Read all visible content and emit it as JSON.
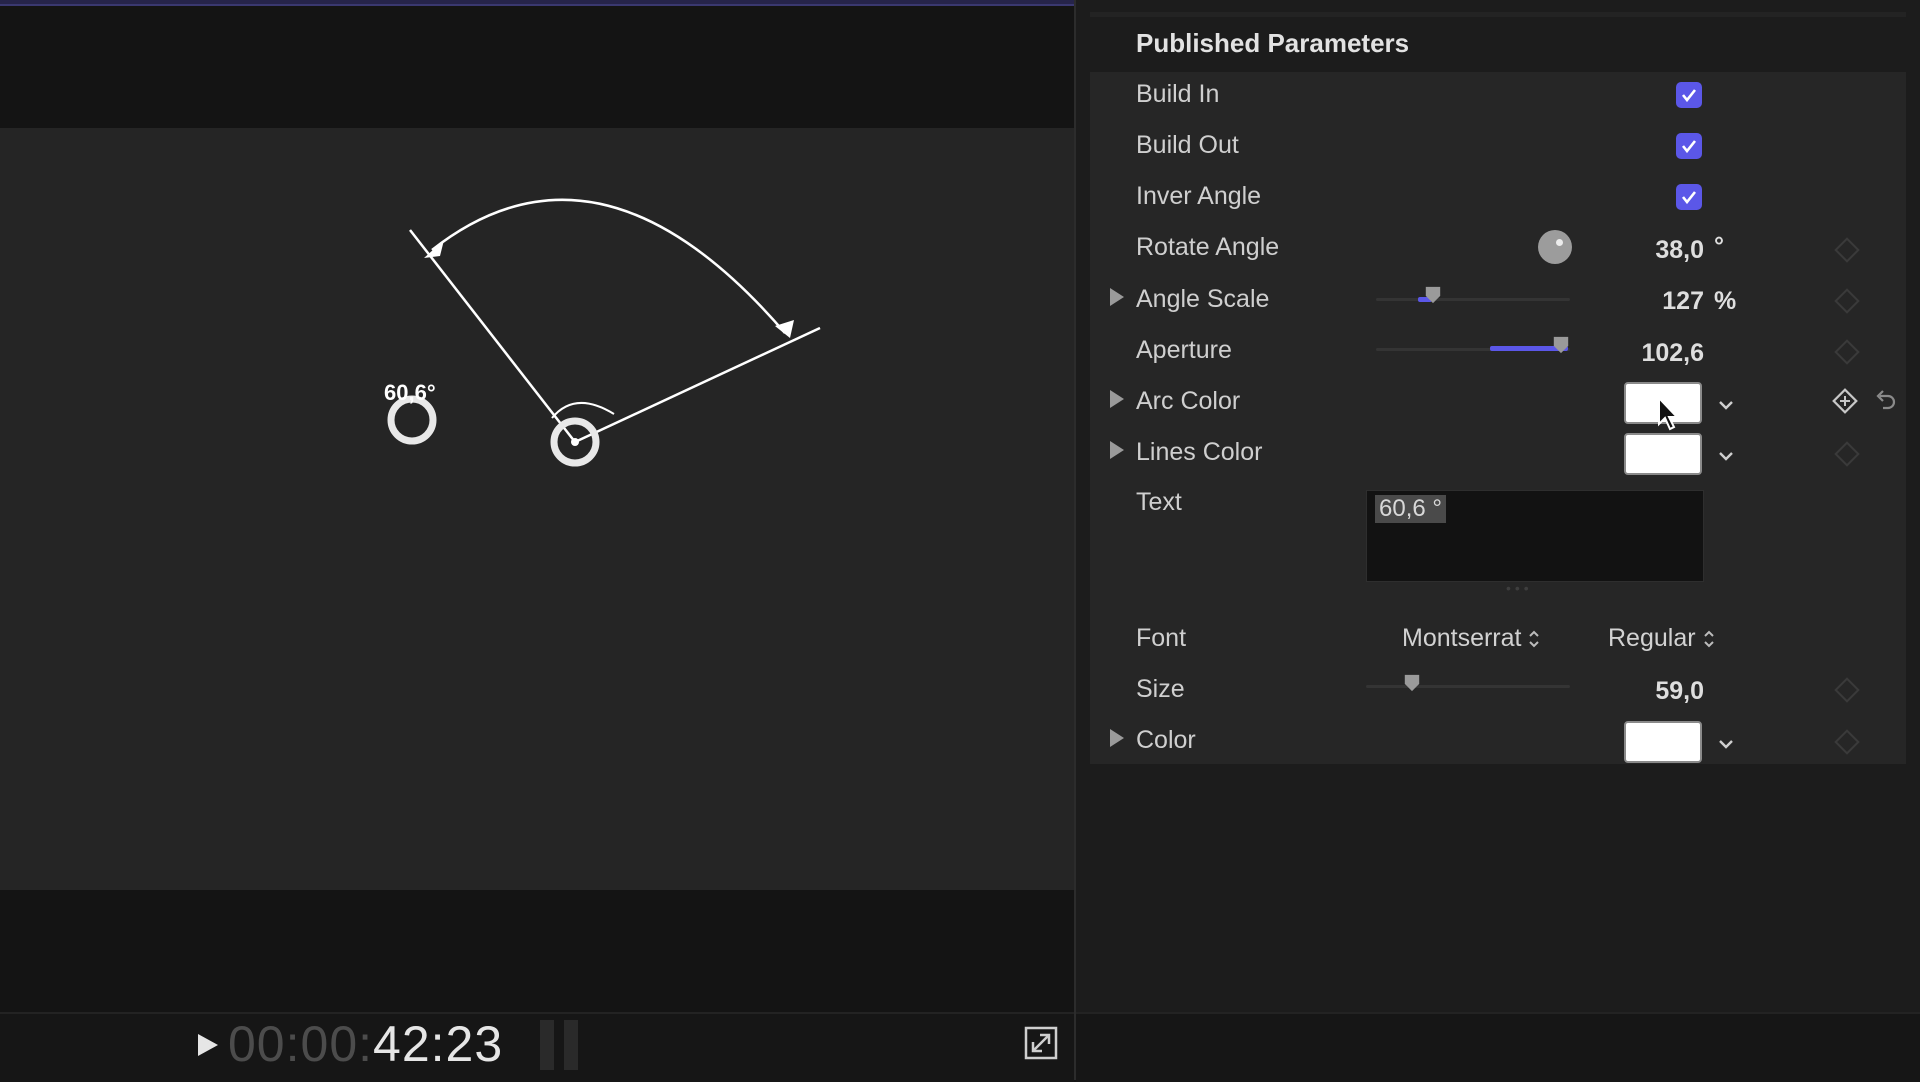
{
  "viewer": {
    "canvas_label": "60,6°",
    "timecode_dim": "00:00:",
    "timecode_bright": "42:23"
  },
  "inspector": {
    "section_title": "Published Parameters",
    "params": {
      "build_in": {
        "label": "Build In",
        "checked": true
      },
      "build_out": {
        "label": "Build Out",
        "checked": true
      },
      "inver_angle": {
        "label": "Inver Angle",
        "checked": true
      },
      "rotate_angle": {
        "label": "Rotate Angle",
        "value": "38,0",
        "unit": "°"
      },
      "angle_scale": {
        "label": "Angle Scale",
        "value": "127",
        "unit": "%"
      },
      "aperture": {
        "label": "Aperture",
        "value": "102,6"
      },
      "arc_color": {
        "label": "Arc Color",
        "color": "#ffffff"
      },
      "lines_color": {
        "label": "Lines Color",
        "color": "#ffffff"
      },
      "text": {
        "label": "Text",
        "value": "60,6 °"
      },
      "font": {
        "label": "Font",
        "family": "Montserrat",
        "style": "Regular"
      },
      "size": {
        "label": "Size",
        "value": "59,0"
      },
      "color": {
        "label": "Color",
        "color": "#ffffff"
      }
    }
  },
  "colors": {
    "accent": "#5b57e8",
    "panel": "#262626",
    "background": "#141414"
  },
  "icons": [
    "play-icon",
    "expand-icon",
    "checkmark-icon",
    "disclosure-triangle-icon",
    "keyframe-diamond-icon",
    "reset-arrow-icon",
    "chevron-down-icon",
    "updown-arrows-icon",
    "mouse-cursor-icon"
  ]
}
